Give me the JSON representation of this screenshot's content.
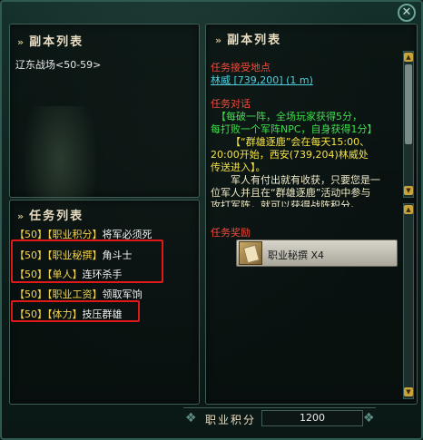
{
  "window": {
    "close_label": "✕"
  },
  "dungeon_panel": {
    "title": "副本列表",
    "items": [
      {
        "label": "辽东战场<50-59>"
      }
    ]
  },
  "quest_panel": {
    "title": "任务列表",
    "rows": [
      {
        "level": "【50】",
        "category": "【职业积分】",
        "name": "将军必须死"
      },
      {
        "level": "【50】",
        "category": "【职业秘撰】",
        "name": "角斗士"
      },
      {
        "level": "【50】",
        "category": "【单人】",
        "name": "连环杀手"
      },
      {
        "level": "【50】",
        "category": "【职业工资】",
        "name": "领取军饷"
      },
      {
        "level": "【50】",
        "category": "【体力】",
        "name": "技压群雄"
      }
    ]
  },
  "detail_panel": {
    "title": "副本列表",
    "accept_heading": "任务接受地点",
    "accept_link": "林威 [739,200] (1 m)",
    "dialog_heading": "任务对话",
    "dialog_green_1": "【每破一阵，全场玩家获得5分，",
    "dialog_green_2": "每打败一个军阵NPC，自身获得1分】",
    "dialog_yellow_1": "【“群雄逐鹿”会在每天15:00、",
    "dialog_yellow_2": "20:00开始，西安(739,204)林威处",
    "dialog_yellow_3": "传送进入】。",
    "dialog_body_1": "军人有付出就有收获，只要您是一",
    "dialog_body_2": "位军人并且在“群雄逐鹿”活动中参与",
    "dialog_body_3": "攻打军阵，就可以获得战阵积分。",
    "reward_heading": "任务奖励",
    "reward_item": "职业秘撰 X4"
  },
  "footer": {
    "points_label": "职业积分",
    "points_value": "1200"
  },
  "colors": {
    "highlight": "#e01818",
    "level": "#f4d24a",
    "heading_red": "#f24a3a",
    "link": "#4fd0e0",
    "green": "#3ee04a"
  }
}
